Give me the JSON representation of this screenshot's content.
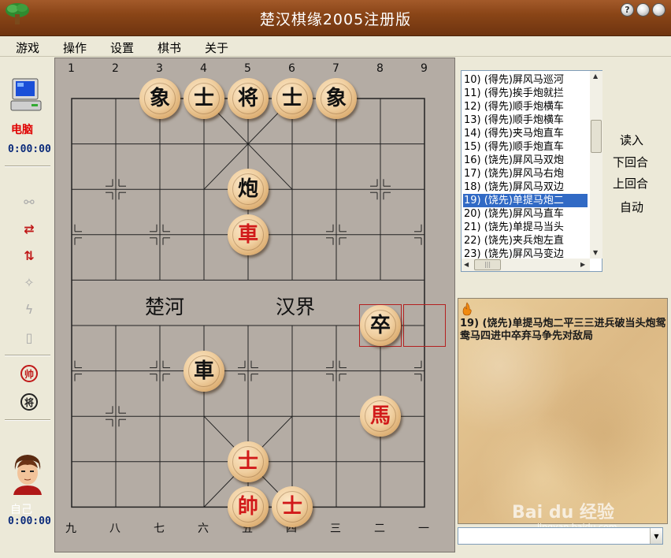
{
  "window": {
    "title": "楚汉棋缘2005注册版",
    "buttons": {
      "help": "?",
      "minimize": "",
      "close": ""
    }
  },
  "menu": [
    "游戏",
    "操作",
    "设置",
    "棋书",
    "关于"
  ],
  "players": {
    "top": {
      "name": "电脑",
      "time": "0:00:00"
    },
    "bottom": {
      "name": "自己",
      "time": "0:00:00"
    }
  },
  "tools": {
    "red_king_badge": "帅",
    "black_king_badge": "将"
  },
  "board": {
    "top_columns": [
      "1",
      "2",
      "3",
      "4",
      "5",
      "6",
      "7",
      "8",
      "9"
    ],
    "bottom_columns": [
      "九",
      "八",
      "七",
      "六",
      "五",
      "四",
      "三",
      "二",
      "一"
    ],
    "river_left": "楚河",
    "river_right": "汉界",
    "pieces": [
      {
        "char": "象",
        "color": "black",
        "file": 3,
        "rank": 0
      },
      {
        "char": "士",
        "color": "black",
        "file": 4,
        "rank": 0
      },
      {
        "char": "将",
        "color": "black",
        "file": 5,
        "rank": 0
      },
      {
        "char": "士",
        "color": "black",
        "file": 6,
        "rank": 0
      },
      {
        "char": "象",
        "color": "black",
        "file": 7,
        "rank": 0
      },
      {
        "char": "炮",
        "color": "black",
        "file": 5,
        "rank": 2
      },
      {
        "char": "車",
        "color": "red",
        "file": 5,
        "rank": 3
      },
      {
        "char": "卒",
        "color": "black",
        "file": 8,
        "rank": 5
      },
      {
        "char": "車",
        "color": "black",
        "file": 4,
        "rank": 6
      },
      {
        "char": "馬",
        "color": "red",
        "file": 8,
        "rank": 7
      },
      {
        "char": "士",
        "color": "red",
        "file": 5,
        "rank": 8
      },
      {
        "char": "帥",
        "color": "red",
        "file": 5,
        "rank": 9
      },
      {
        "char": "士",
        "color": "red",
        "file": 6,
        "rank": 9
      }
    ],
    "last_move": {
      "from_file": 9,
      "from_rank": 5,
      "to_file": 8,
      "to_rank": 5
    }
  },
  "game_list": {
    "items": [
      "10) (得先)屏风马巡河",
      "11) (得先)挨手炮就拦",
      "12) (得先)顺手炮横车",
      "13) (得先)顺手炮横车",
      "14) (得先)夹马炮直车",
      "15) (得先)顺手炮直车",
      "16) (饶先)屏风马双炮",
      "17) (饶先)屏风马右炮",
      "18) (饶先)屏风马双边",
      "19) (饶先)单提马炮二",
      "20) (饶先)屏风马直车",
      "21) (饶先)单提马当头",
      "22) (饶先)夹兵炮左直",
      "23) (饶先)屏风马变边"
    ],
    "selected_index": 9,
    "scroll_grip": "|||"
  },
  "side_buttons": [
    "读入",
    "下回合",
    "上回合",
    "自动"
  ],
  "notes": {
    "text": "19) (饶先)单提马炮二平三三进兵破当头炮鸳鸯马四进中卒弃马争先对敌局"
  },
  "watermark": {
    "brand": "Bai du 经验",
    "url": "jingyan.baidu.com"
  },
  "combo": {
    "value": ""
  }
}
